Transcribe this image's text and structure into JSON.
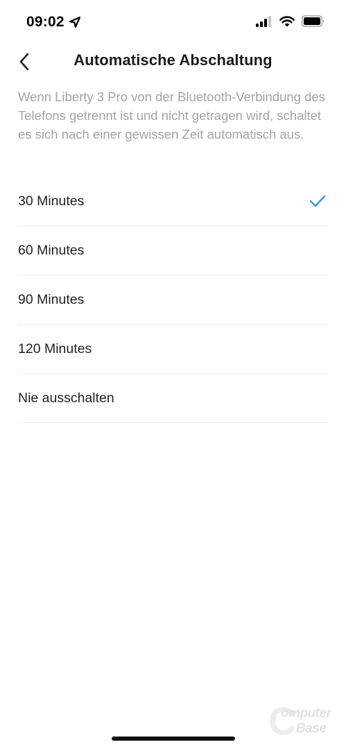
{
  "status_bar": {
    "time": "09:02",
    "location_icon": "location-arrow-icon",
    "signal_icon": "cellular-signal-icon",
    "wifi_icon": "wifi-icon",
    "battery_icon": "battery-icon"
  },
  "header": {
    "back_icon": "chevron-left-icon",
    "title": "Automatische Abschaltung"
  },
  "description": "Wenn Liberty 3 Pro von der Bluetooth-Verbindung des Telefons getrennt ist und nicht getragen wird, schaltet es sich nach einer gewissen Zeit automatisch aus.",
  "options": [
    {
      "label": "30 Minutes",
      "selected": true
    },
    {
      "label": "60 Minutes",
      "selected": false
    },
    {
      "label": "90 Minutes",
      "selected": false
    },
    {
      "label": "120 Minutes",
      "selected": false
    },
    {
      "label": "Nie ausschalten",
      "selected": false
    }
  ],
  "colors": {
    "accent": "#3d9bd8",
    "description_text": "#a3a3a3",
    "divider": "#eeeeee"
  },
  "watermark": {
    "line1": "omputer",
    "line2": "Base",
    "letter": "C"
  }
}
